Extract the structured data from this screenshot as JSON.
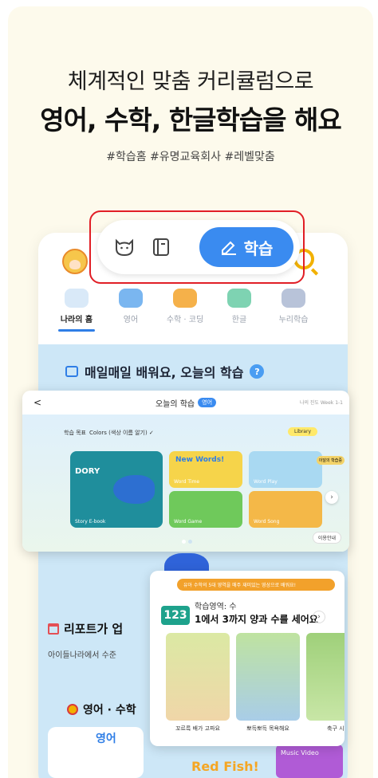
{
  "hero": {
    "line1": "체계적인 맞춤 커리큘럼으로",
    "line2": "영어, 수학, 한글학습을 해요",
    "tags": "#학습홈 #유명교육회사 #레벨맞춤"
  },
  "nav_pill": {
    "study_button": "학습"
  },
  "categories": [
    {
      "label": "나라의 홈",
      "active": true
    },
    {
      "label": "영어",
      "active": false
    },
    {
      "label": "수학 · 코딩",
      "active": false
    },
    {
      "label": "한글",
      "active": false
    },
    {
      "label": "누리학습",
      "active": false
    }
  ],
  "section": {
    "title": "매일매일 배워요, 오늘의 학습",
    "help": "?"
  },
  "tablet": {
    "back": "<",
    "title": "오늘의 학습",
    "badge": "영어",
    "progress": "나의 진도 Week 1-1",
    "goal_label": "학습 목표",
    "goal_value": "Colors (색상 이름 알기) ✓",
    "library": "Library",
    "big_tile_title": "DORY",
    "big_tile_label": "Story E-book",
    "tiles": [
      {
        "label": "Word Time",
        "title": "New Words!"
      },
      {
        "label": "Word Play",
        "title": ""
      },
      {
        "label": "Word Game",
        "title": ""
      },
      {
        "label": "Word Song",
        "title": ""
      }
    ],
    "next": "›",
    "guide": "이용안내",
    "side_bubble": "이달의 학습중"
  },
  "math_card": {
    "banner": "유아 수학의 5대 영역을 매주 재미있는 영상으로 배워요!",
    "badge": "123",
    "subject": "학습영역: 수",
    "title": "1에서 3까지 양과 수를 세어요",
    "chevron": "›",
    "videos": [
      {
        "caption": "꼬르륵 배가 고파요"
      },
      {
        "caption": "뽀득뽀득 목욕해요"
      },
      {
        "caption": "축구 시합"
      }
    ]
  },
  "report": {
    "title": "리포트가 업",
    "sub": "아이들나라에서 수준"
  },
  "eng_math": {
    "title": "영어 · 수학"
  },
  "bottom": {
    "english": "영어",
    "red_fish": "Red Fish!",
    "music": "Music Video"
  },
  "colors": {
    "accent_blue": "#3a8bf0",
    "highlight_red": "#e11e26",
    "math_green": "#1ea28c",
    "banner_orange": "#f2a12b"
  }
}
